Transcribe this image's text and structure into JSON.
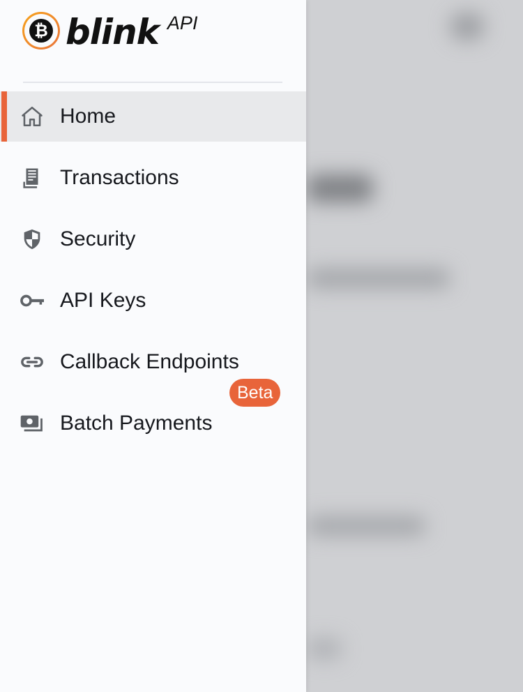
{
  "brand": {
    "name": "blink",
    "suffix": "API",
    "coin_symbol": "₿",
    "accent_color": "#e8643a"
  },
  "nav": {
    "items": [
      {
        "label": "Home",
        "icon": "home-icon",
        "active": true
      },
      {
        "label": "Transactions",
        "icon": "receipt-icon",
        "active": false
      },
      {
        "label": "Security",
        "icon": "shield-icon",
        "active": false
      },
      {
        "label": "API Keys",
        "icon": "key-icon",
        "active": false
      },
      {
        "label": "Callback Endpoints",
        "icon": "link-icon",
        "active": false
      },
      {
        "label": "Batch Payments",
        "icon": "payments-icon",
        "active": false,
        "badge": "Beta"
      }
    ]
  }
}
